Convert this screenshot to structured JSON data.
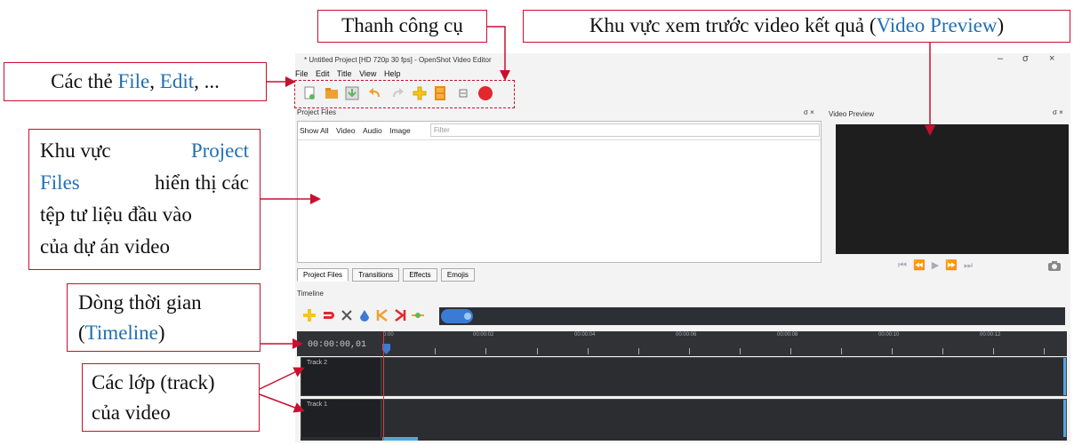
{
  "callouts": {
    "toolbar": "Thanh công cụ",
    "preview_prefix": "Khu vực xem trước video kết quả (",
    "preview_highlight": "Video Preview",
    "preview_suffix": ")",
    "tabs_prefix": "Các thẻ ",
    "tabs_file": "File",
    "tabs_sep": ", ",
    "tabs_edit": "Edit",
    "tabs_suffix": ", ...",
    "project_line1": "Khu vực",
    "project_highlight1": "Project",
    "project_highlight2": "Files",
    "project_line2_rest": "hiển thị các",
    "project_line3": "tệp tư liệu đầu vào",
    "project_line4": "của dự án video",
    "timeline_line1": "Dòng thời gian",
    "timeline_open": "(",
    "timeline_highlight": "Timeline",
    "timeline_close": ")",
    "tracks_line1": "Các lớp (track)",
    "tracks_line2": "của video"
  },
  "app": {
    "window_title": "* Untitled Project [HD 720p 30 fps] - OpenShot Video Editor",
    "window_controls": [
      "–",
      "σ",
      "×"
    ],
    "menu": [
      "File",
      "Edit",
      "Title",
      "View",
      "Help"
    ],
    "toolbar_icons": [
      "new-project-icon",
      "open-project-icon",
      "save-project-icon",
      "undo-icon",
      "redo-icon",
      "import-files-icon",
      "profile-icon",
      "fullscreen-icon",
      "export-video-icon"
    ],
    "project_files_title": "Project Files",
    "filter_tabs": [
      "Show All",
      "Video",
      "Audio",
      "Image"
    ],
    "filter_placeholder": "Filter",
    "dock_tabs": [
      "Project Files",
      "Transitions",
      "Effects",
      "Emojis"
    ],
    "preview_title": "Video Preview",
    "dock_buttons": "σ ×",
    "player_controls": "⏮ ⏪ ▶ ⏩ ⏭",
    "timeline_title": "Timeline",
    "timeline_tools": [
      "add-track-icon",
      "snap-icon",
      "razor-icon",
      "add-marker-icon",
      "previous-marker-icon",
      "next-marker-icon",
      "center-playhead-icon"
    ],
    "time_readout": "00:00:00,01",
    "ruler_labels": [
      "0:00",
      "00:00:02",
      "00:00:04",
      "00:00:06",
      "00:00:08",
      "00:00:10",
      "00:00:12"
    ],
    "tracks": [
      "Track 2",
      "Track 1"
    ]
  },
  "colors": {
    "callout_border": "#c8102e",
    "highlight_blue": "#1f6fb2",
    "play_green": "#7ac943",
    "record_red": "#e0282e",
    "timeline_dark": "#2b2d31",
    "playhead": "#e03a3a",
    "track_edge": "#4fa7e0"
  }
}
